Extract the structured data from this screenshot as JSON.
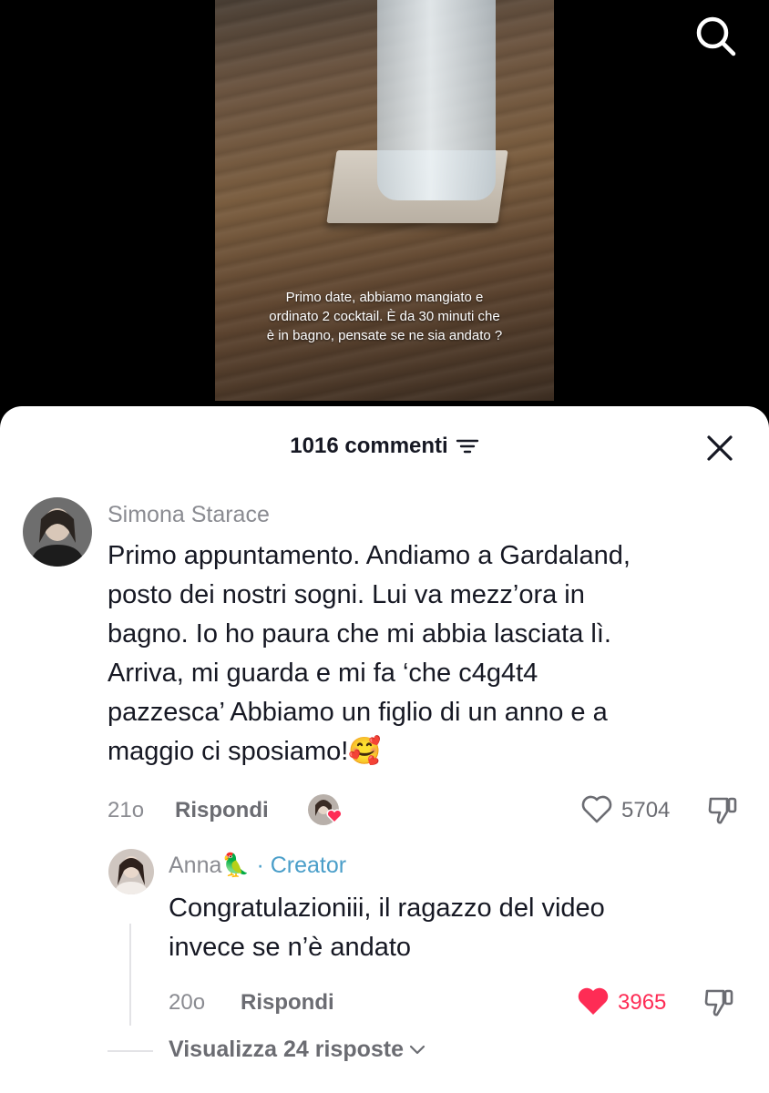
{
  "video": {
    "caption": "Primo date, abbiamo mangiato e\nordinato 2 cocktail. È da 30 minuti che\nè in bagno, pensate se ne sia andato ?"
  },
  "icons": {
    "search": "search-icon",
    "filter": "filter-icon",
    "close": "close-icon",
    "heart": "heart-icon",
    "dislike": "thumbs-down-icon",
    "chevron": "chevron-down-icon"
  },
  "colors": {
    "liked_heart": "#fe2c55",
    "creator_label": "#4a9ec9",
    "muted_text": "#8a8b91"
  },
  "header": {
    "comments_count": "1016 commenti"
  },
  "comment": {
    "author": "Simona Starace",
    "text": "Primo appuntamento. Andiamo a Gardaland,\nposto dei nostri sogni. Lui va mezz’ora in\nbagno. Io ho paura che mi abbia lasciata lì.\nArriva, mi guarda e mi fa ‘che c4g4t4\npazzesca’ Abbiamo un figlio di un anno e a\nmaggio ci sposiamo!🥰",
    "age": "21o",
    "reply_label": "Rispondi",
    "likes": "5704"
  },
  "reply": {
    "author": "Anna🦜",
    "creator_label": "· Creator",
    "text": "Congratulazioniii, il ragazzo del video\ninvece se n’è andato",
    "age": "20o",
    "reply_label": "Rispondi",
    "likes": "3965"
  },
  "view_replies": {
    "label": "Visualizza 24 risposte"
  }
}
